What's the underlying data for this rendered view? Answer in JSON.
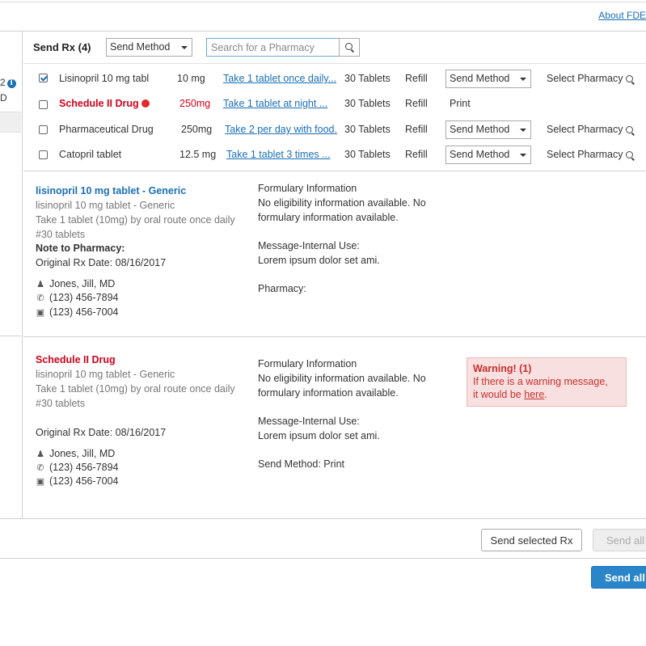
{
  "header": {
    "about_link": "About FDE"
  },
  "left_pane": {
    "number": "2",
    "letter": "D"
  },
  "toolbar": {
    "title": "Send Rx (4)",
    "send_method": "Send Method",
    "search_placeholder": "Search for a Pharmacy"
  },
  "rx_rows": [
    {
      "checked": true,
      "name": "Lisinopril 10 mg tabl",
      "dose": "10 mg",
      "sig": "Take 1 tablet once daily...",
      "qty": "30 Tablets",
      "refill": "Refill",
      "method": "Send Method",
      "pharmacy": "Select Pharmacy"
    },
    {
      "checked": false,
      "name": "Schedule II Drug",
      "dose": "250mg",
      "sig": "Take 1 tablet at night     ...",
      "qty": "30 Tablets",
      "refill": "Refill",
      "method": "Print",
      "pharmacy": ""
    },
    {
      "checked": false,
      "name": "Pharmaceutical Drug",
      "dose": "250mg",
      "sig": "Take 2 per day with food.",
      "qty": "30 Tablets",
      "refill": "Refill",
      "method": "Send Method",
      "pharmacy": "Select Pharmacy"
    },
    {
      "checked": false,
      "name": "Catopril tablet",
      "dose": "12.5 mg",
      "sig": "Take 1 tablet 3 times     ...",
      "qty": "30 Tablets",
      "refill": "Refill",
      "method": "Send Method",
      "pharmacy": "Select Pharmacy"
    }
  ],
  "details": [
    {
      "title": "lisinopril 10 mg tablet - Generic",
      "generic": "lisinopril 10 mg tablet - Generic",
      "sig": "Take 1 tablet (10mg) by oral route once daily",
      "qty": "#30 tablets",
      "note_label": "Note to Pharmacy:",
      "orig_date": "Original Rx Date: 08/16/2017",
      "prescriber": "Jones, Jill, MD",
      "phone": "(123) 456-7894",
      "fax": "(123) 456-7004",
      "formulary_label": "Formulary Information",
      "formulary_text1": "No eligibility information available. No",
      "formulary_text2": "formulary information available.",
      "message_label": "Message-Internal Use:",
      "message_text": "Lorem ipsum dolor set ami.",
      "extra": "Pharmacy:"
    },
    {
      "title": "Schedule II Drug",
      "generic": "lisinopril 10 mg tablet - Generic",
      "sig": "Take 1 tablet (10mg) by oral route once daily",
      "qty": "#30 tablets",
      "orig_date": "Original Rx Date: 08/16/2017",
      "prescriber": "Jones, Jill, MD",
      "phone": "(123) 456-7894",
      "fax": "(123) 456-7004",
      "formulary_label": "Formulary Information",
      "formulary_text1": "No eligibility information available. No",
      "formulary_text2": "formulary information available.",
      "message_label": "Message-Internal Use:",
      "message_text": "Lorem ipsum dolor set ami.",
      "extra": "Send Method: Print",
      "warning": {
        "title": "Warning! (1)",
        "text1": "If there is a warning message,",
        "text2": "it would be",
        "link": "here",
        "end": "."
      }
    }
  ],
  "footer": {
    "send_selected": "Send selected Rx",
    "send_all_disabled": "Send all",
    "send_all": "Send all"
  },
  "colors": {
    "link": "#1a6fb5",
    "danger": "#d0021b",
    "primary": "#2a85c9"
  }
}
